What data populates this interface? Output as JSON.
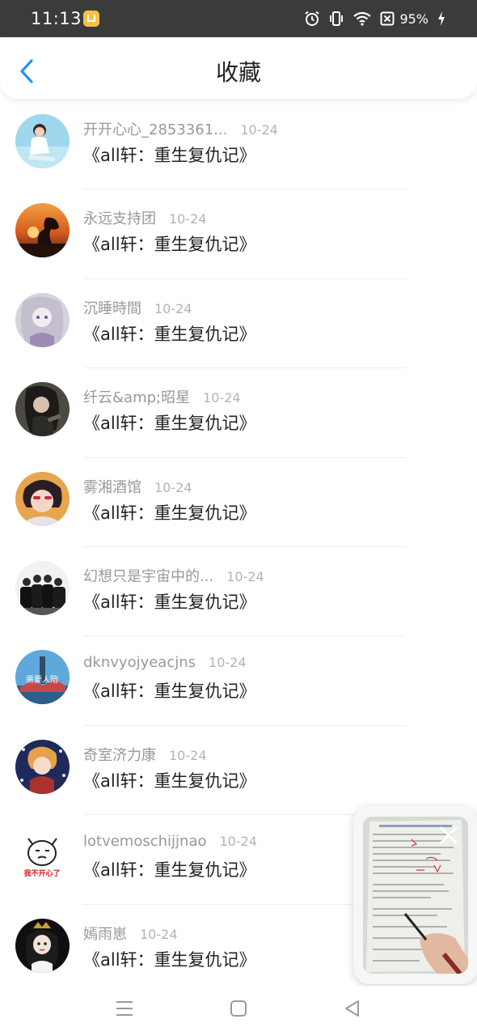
{
  "status_bar": {
    "time": "11:13",
    "battery": "95%",
    "icons": [
      "alarm-icon",
      "vibrate-icon",
      "wifi-icon",
      "sim-off-icon",
      "battery-charging-icon"
    ]
  },
  "header": {
    "title": "收藏",
    "back_icon": "chevron-left-icon",
    "accent_color": "#2196f3"
  },
  "items": [
    {
      "username": "开开心心_2853361...",
      "date": "10-24",
      "title": "《all轩：重生复仇记》"
    },
    {
      "username": "永远支持团",
      "date": "10-24",
      "title": "《all轩：重生复仇记》"
    },
    {
      "username": "沉睡時間",
      "date": "10-24",
      "title": "《all轩：重生复仇记》"
    },
    {
      "username": "纤云&amp;昭星",
      "date": "10-24",
      "title": "《all轩：重生复仇记》"
    },
    {
      "username": "雾湘酒馆",
      "date": "10-24",
      "title": "《all轩：重生复仇记》"
    },
    {
      "username": "幻想只是宇宙中的...",
      "date": "10-24",
      "title": "《all轩：重生复仇记》"
    },
    {
      "username": "dknvyojyeacjns",
      "date": "10-24",
      "title": "《all轩：重生复仇记》"
    },
    {
      "username": "奇室济力康",
      "date": "10-24",
      "title": "《all轩：重生复仇记》"
    },
    {
      "username": "lotvemoschijjnao",
      "date": "10-24",
      "title": "《all轩：重生复仇记》"
    },
    {
      "username": "嫣雨崽",
      "date": "10-24",
      "title": "《all轩：重生复仇记》"
    }
  ],
  "avatar_texts": {
    "item7": "需要人陪",
    "item9": "我不开心了"
  },
  "floating_video": {
    "close_icon": "close-icon"
  },
  "nav_bar": {
    "icons": [
      "menu-icon",
      "home-icon",
      "back-triangle-icon"
    ]
  }
}
